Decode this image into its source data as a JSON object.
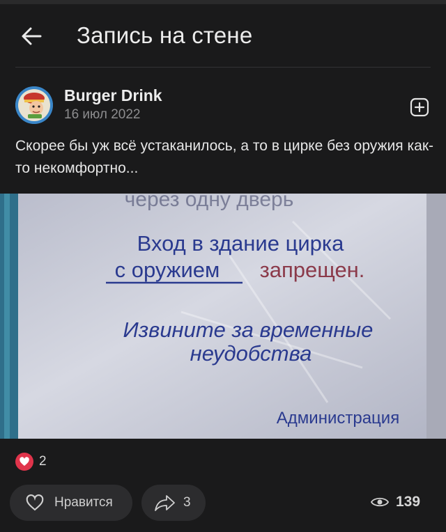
{
  "header": {
    "title": "Запись на стене"
  },
  "post": {
    "author": "Burger Drink",
    "date_day_month": "16 июл",
    "date_year": "2022",
    "text": "Скорее бы уж всё устаканилось, а то в цирке без оружия как-то некомфортно..."
  },
  "photo": {
    "top_fragment": "через одну дверь",
    "line1": "Вход в здание цирка",
    "line2a": "с оружием",
    "line2b": "запрещен.",
    "line3": "Извините за временные",
    "line4": "неудобства",
    "signature": "Администрация"
  },
  "reactions": {
    "likes_count": "2"
  },
  "actions": {
    "like_label": "Нравится",
    "share_count": "3",
    "views_count": "139"
  },
  "colors": {
    "background": "#1a1a1b",
    "heart": "#e0344b",
    "pill": "#2c2c2e"
  }
}
